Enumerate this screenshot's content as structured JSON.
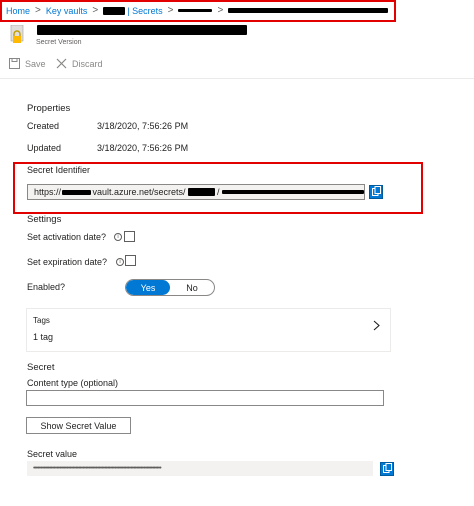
{
  "breadcrumb": {
    "items": [
      "Home",
      "Key vaults",
      "| Secrets"
    ],
    "separator": ">"
  },
  "blade": {
    "subtitle": "Secret Version"
  },
  "toolbar": {
    "save_label": "Save",
    "discard_label": "Discard"
  },
  "properties": {
    "heading": "Properties",
    "created_label": "Created",
    "created_value": "3/18/2020, 7:56:26 PM",
    "updated_label": "Updated",
    "updated_value": "3/18/2020, 7:56:26 PM"
  },
  "identifier": {
    "label": "Secret Identifier",
    "value_prefix": "https://",
    "value_middle": "vault.azure.net/secrets/",
    "value_sep": "/"
  },
  "settings": {
    "heading": "Settings",
    "activation_label": "Set activation date?",
    "expiration_label": "Set expiration date?",
    "enabled_label": "Enabled?",
    "enabled_yes": "Yes",
    "enabled_no": "No",
    "enabled_value": "Yes"
  },
  "tags": {
    "label": "Tags",
    "count_text": "1 tag"
  },
  "secret": {
    "heading": "Secret",
    "content_type_label": "Content type (optional)",
    "content_type_value": "",
    "show_button": "Show Secret Value",
    "value_label": "Secret value",
    "value_masked": "••••••••••••••••••••••••••••••••••••••••••••••••••••••••••••••••••••••••••••••••••••••••"
  },
  "colors": {
    "accent": "#0078d4",
    "highlight_border": "#e30000",
    "redaction": "#000000"
  },
  "icons": [
    "key-vault-secret-icon",
    "save-icon",
    "discard-icon",
    "copy-icon",
    "info-icon",
    "chevron-right-icon"
  ]
}
